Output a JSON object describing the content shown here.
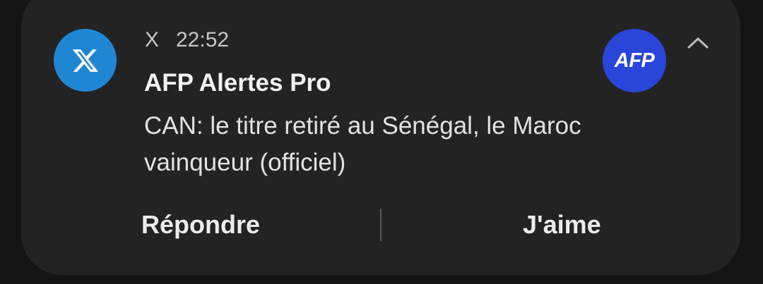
{
  "notification": {
    "app_icon": "x-logo-icon",
    "app_name": "X",
    "time": "22:52",
    "sender": "AFP Alertes Pro",
    "message": "CAN: le titre retiré au Sénégal, le Maroc vainqueur (officiel)",
    "avatar_text": "AFP",
    "collapse_icon": "chevron-up-icon",
    "colors": {
      "app_icon_bg": "#1f86d4",
      "avatar_bg": "#2a45d9",
      "card_bg": "#232323"
    }
  },
  "actions": {
    "reply_label": "Répondre",
    "like_label": "J'aime"
  }
}
